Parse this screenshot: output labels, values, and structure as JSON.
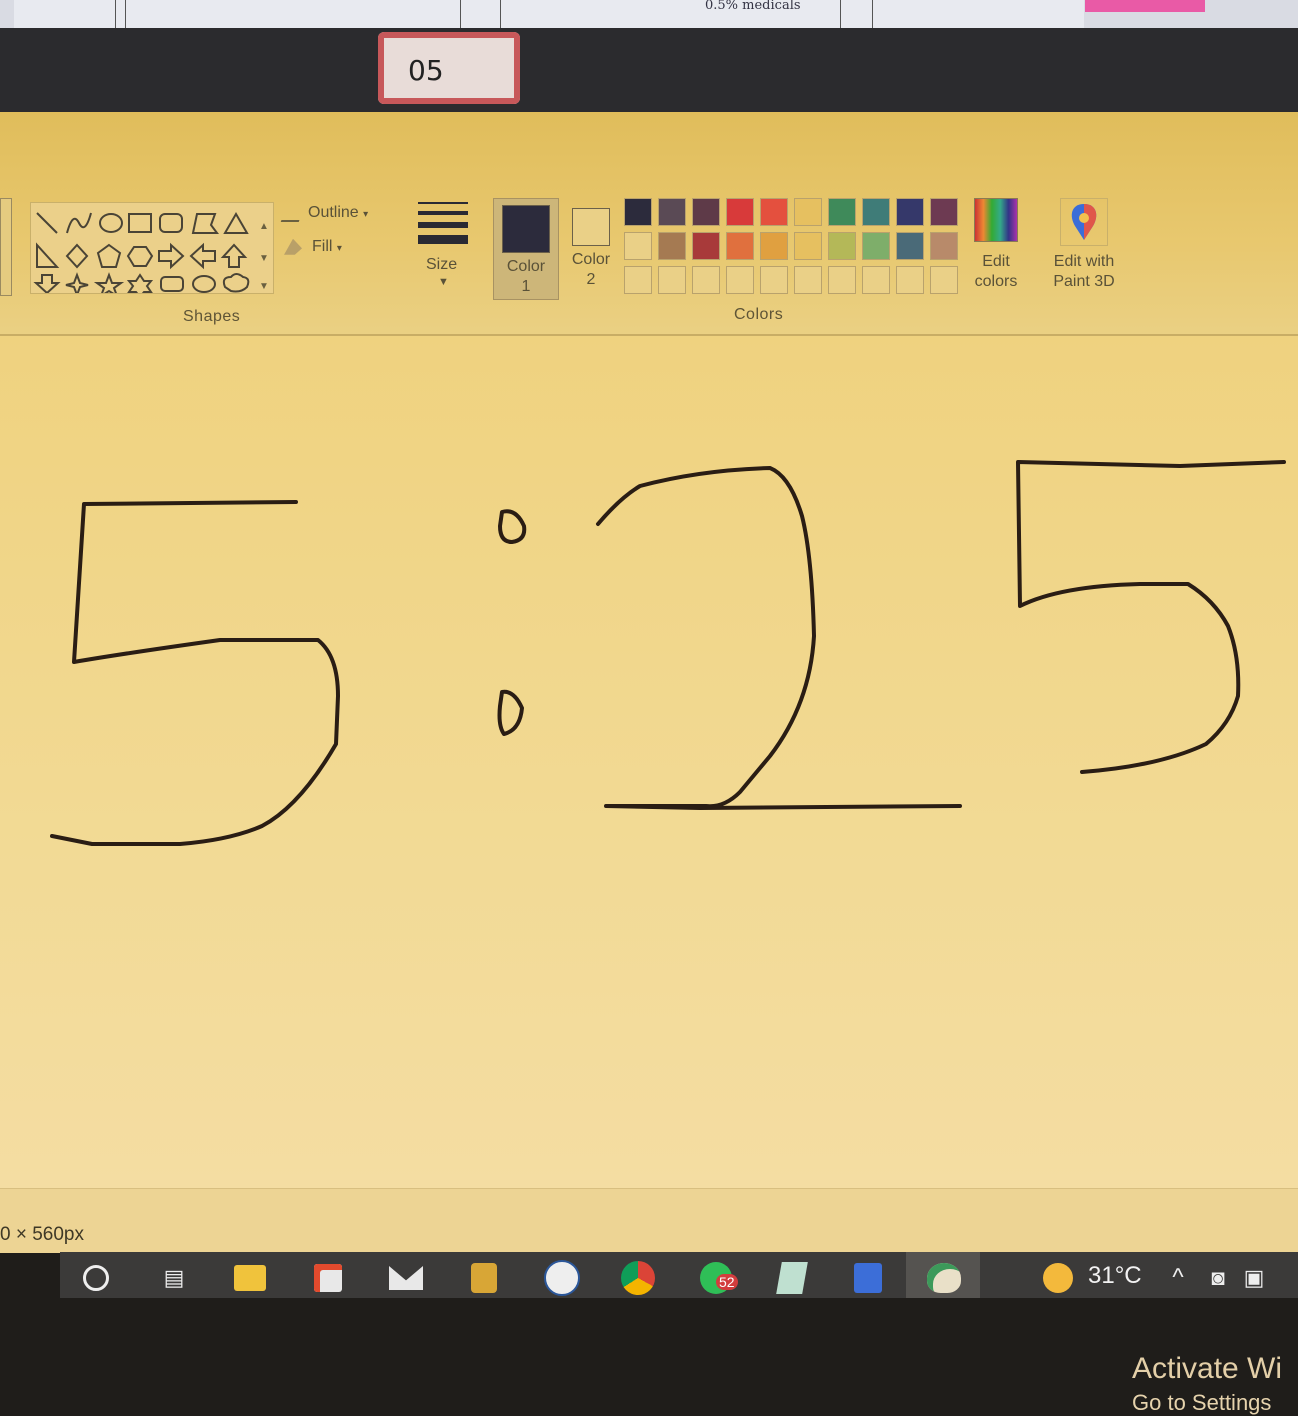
{
  "top_note": "0.5% medicals",
  "sticker_text": "05",
  "ribbon": {
    "shapes_label": "Shapes",
    "outline_label": "Outline",
    "fill_label": "Fill",
    "size_label": "Size",
    "color1_label": "Color 1",
    "color2_label": "Color 2",
    "colors_label": "Colors",
    "edit_colors_label": "Edit colors",
    "edit_paint3d_label": "Edit with Paint 3D",
    "shape_icons": [
      "line-icon",
      "curve-icon",
      "oval-icon",
      "rectangle-icon",
      "rounded-rectangle-icon",
      "polygon-icon",
      "triangle-icon",
      "right-triangle-icon",
      "diamond-icon",
      "pentagon-icon",
      "hexagon-icon",
      "right-arrow-icon",
      "left-arrow-icon",
      "up-arrow-icon",
      "down-arrow-icon",
      "four-point-star-icon",
      "five-point-star-icon",
      "six-point-star-icon",
      "rounded-callout-icon",
      "oval-callout-icon",
      "cloud-callout-icon"
    ],
    "color1": "#2c2b3c",
    "color2": "#ead087",
    "palette_row1": [
      "#2c2b3c",
      "#5a4a55",
      "#5e3a48",
      "#d83a3a",
      "#e4503e",
      "#e6c060",
      "#3f8a5a",
      "#3f7c78",
      "#35386a",
      "#6d3a52"
    ],
    "palette_row2": [
      "#ead087",
      "#a57a52",
      "#a83a3a",
      "#e0703e",
      "#e0a040",
      "#e6c060",
      "#b4b858",
      "#7eae6a",
      "#4a6a78",
      "#b88a6a"
    ],
    "palette_row3": [
      "#ead087",
      "#ead087",
      "#ead087",
      "#ead087",
      "#ead087",
      "#ead087",
      "#ead087",
      "#ead087",
      "#ead087",
      "#ead087"
    ]
  },
  "canvas": {
    "watermark_line1": "Activate Wi",
    "watermark_line2": "Go to Settings"
  },
  "status": {
    "dimensions": "0 × 560px"
  },
  "taskbar": {
    "icons": [
      "cortana-search-icon",
      "task-view-icon",
      "file-explorer-icon",
      "microsoft-store-icon",
      "mail-icon",
      "snipping-tool-icon",
      "word-icon",
      "chrome-icon",
      "whatsapp-icon",
      "notepad-icon",
      "paint-installer-icon",
      "paint-icon"
    ],
    "whatsapp_badge": "52",
    "temperature": "31°C"
  }
}
